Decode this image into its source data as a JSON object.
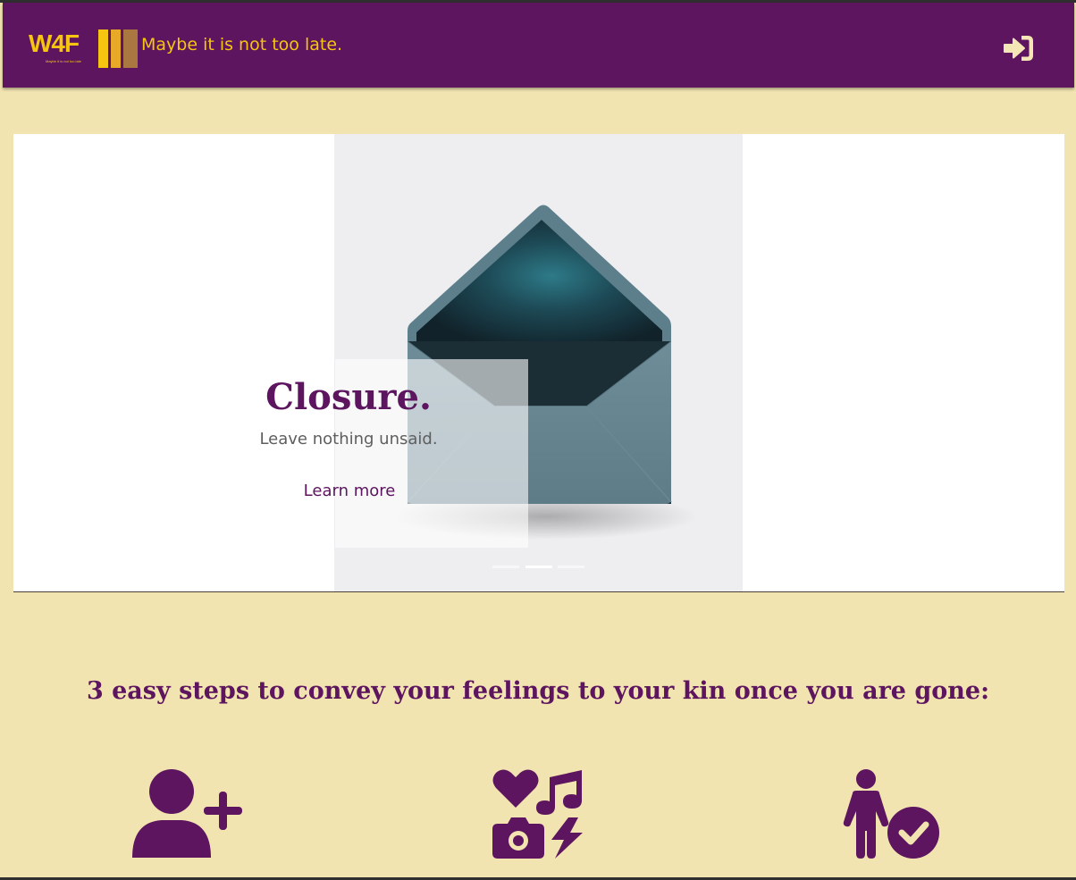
{
  "header": {
    "logo_text": "W4F",
    "logo_subtext": "Maybe it is not too late",
    "tagline": "Maybe it is not too late.",
    "login_icon": "sign-in-icon"
  },
  "hero": {
    "slide": {
      "title": "Closure.",
      "subtitle": "Leave nothing unsaid.",
      "link_label": "Learn more",
      "image": "open-envelope"
    },
    "indicator_count": 3,
    "active_index": 1
  },
  "steps": {
    "heading": "3 easy steps to convey your feelings to your kin once you are gone:",
    "items": [
      {
        "icon": "user-plus-icon"
      },
      {
        "icon": "media-icons"
      },
      {
        "icon": "person-check-icon"
      }
    ]
  },
  "colors": {
    "brand_purple": "#5c155e",
    "brand_yellow": "#f6c511",
    "background": "#f2e4b1",
    "logo_bar_orange": "#e8a928",
    "logo_bar_brown": "#a9773f"
  }
}
